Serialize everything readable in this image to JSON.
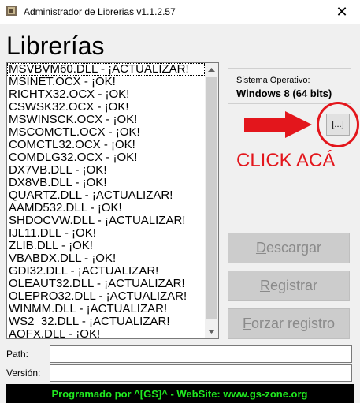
{
  "window": {
    "title": "Administrador de Librerias v1.1.2.57",
    "close_glyph": "✕"
  },
  "heading": "Librerías",
  "libraries": [
    "MSVBVM60.DLL - ¡ACTUALIZAR!",
    "MSINET.OCX - ¡OK!",
    "RICHTX32.OCX - ¡OK!",
    "CSWSK32.OCX - ¡OK!",
    "MSWINSCK.OCX - ¡OK!",
    "MSCOMCTL.OCX - ¡OK!",
    "COMCTL32.OCX - ¡OK!",
    "COMDLG32.OCX - ¡OK!",
    "DX7VB.DLL - ¡OK!",
    "DX8VB.DLL - ¡OK!",
    "QUARTZ.DLL - ¡ACTUALIZAR!",
    "AAMD532.DLL - ¡OK!",
    "SHDOCVW.DLL - ¡ACTUALIZAR!",
    "IJL11.DLL - ¡OK!",
    "ZLIB.DLL - ¡OK!",
    "VBABDX.DLL - ¡OK!",
    "GDI32.DLL - ¡ACTUALIZAR!",
    "OLEAUT32.DLL - ¡ACTUALIZAR!",
    "OLEPRO32.DLL - ¡ACTUALIZAR!",
    "WINMM.DLL - ¡ACTUALIZAR!",
    "WS2_32.DLL - ¡ACTUALIZAR!",
    "AOFX.DLL - ¡OK!"
  ],
  "system": {
    "label": "Sistema Operativo:",
    "value": "Windows 8 (64 bits)"
  },
  "browse_button": "[...]",
  "annotation": {
    "text": "CLICK ACÁ",
    "color": "#e3161c"
  },
  "buttons": {
    "descargar": {
      "mnemonic": "D",
      "rest": "escargar"
    },
    "registrar": {
      "mnemonic": "R",
      "rest": "egistrar"
    },
    "forzar": {
      "mnemonic": "F",
      "rest": "orzar registro"
    }
  },
  "fields": {
    "path_label": "Path:",
    "path_value": "",
    "version_label": "Versión:",
    "version_value": ""
  },
  "footer": {
    "text": "Programado por ^[GS]^ - WebSite: www.gs-zone.org",
    "color": "#20e820"
  },
  "icons": {
    "app": "app-icon",
    "close": "close-icon",
    "scroll_up": "arrow-up-icon",
    "scroll_down": "arrow-down-icon"
  }
}
